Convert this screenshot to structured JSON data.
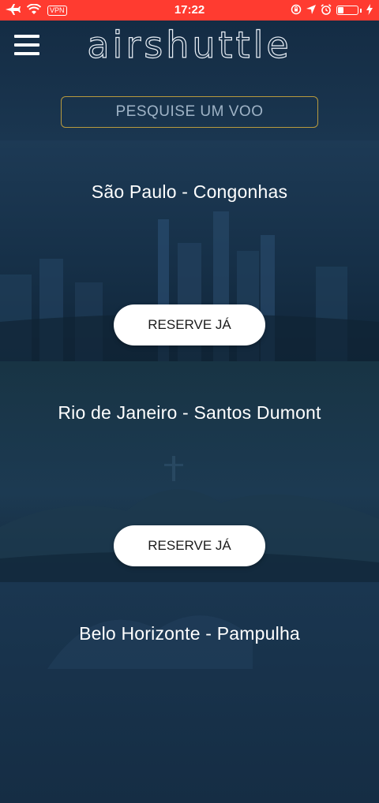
{
  "status_bar": {
    "vpn": "VPN",
    "time": "17:22",
    "battery_level": 0.3,
    "icons": [
      "airplane-icon",
      "wifi-icon",
      "rotation-lock-icon",
      "location-icon",
      "alarm-icon",
      "battery-icon",
      "charging-icon"
    ]
  },
  "header": {
    "logo": "airshuttle",
    "menu_icon": "hamburger-icon",
    "search_placeholder": "PESQUISE UM VOO"
  },
  "destinations": [
    {
      "title": "São Paulo - Congonhas",
      "button": "RESERVE JÁ"
    },
    {
      "title": "Rio de Janeiro - Santos Dumont",
      "button": "RESERVE JÁ"
    },
    {
      "title": "Belo Horizonte - Pampulha"
    }
  ],
  "colors": {
    "status_bar": "#ff3b30",
    "search_border": "#b89a3e",
    "background": "#0e2236",
    "button_bg": "#ffffff"
  }
}
